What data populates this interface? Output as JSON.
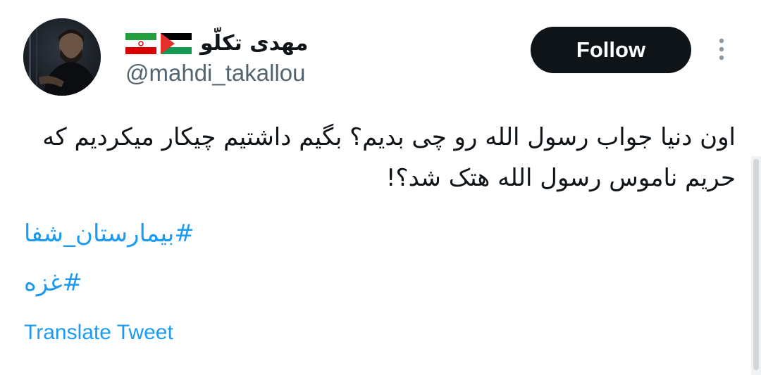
{
  "tweet": {
    "author": {
      "display_name": "مهدی تکلّو",
      "flags": [
        "palestine-flag",
        "iran-flag"
      ],
      "handle": "@mahdi_takallou",
      "avatar_icon": "avatar-photo"
    },
    "follow_label": "Follow",
    "more_icon": "more-vertical-icon",
    "text": "اون دنیا جواب رسول الله رو چی بدیم؟ بگیم داشتیم چیکار میکردیم که حریم ناموس رسول الله هتک شد؟!",
    "hashtags": [
      "#بیمارستان_شفا",
      "#غزه"
    ],
    "translate_label": "Translate Tweet"
  },
  "colors": {
    "link": "#1d9bf0",
    "text": "#0f1419",
    "secondary_text": "#536471",
    "button_bg": "#0f1419",
    "button_text": "#ffffff"
  }
}
